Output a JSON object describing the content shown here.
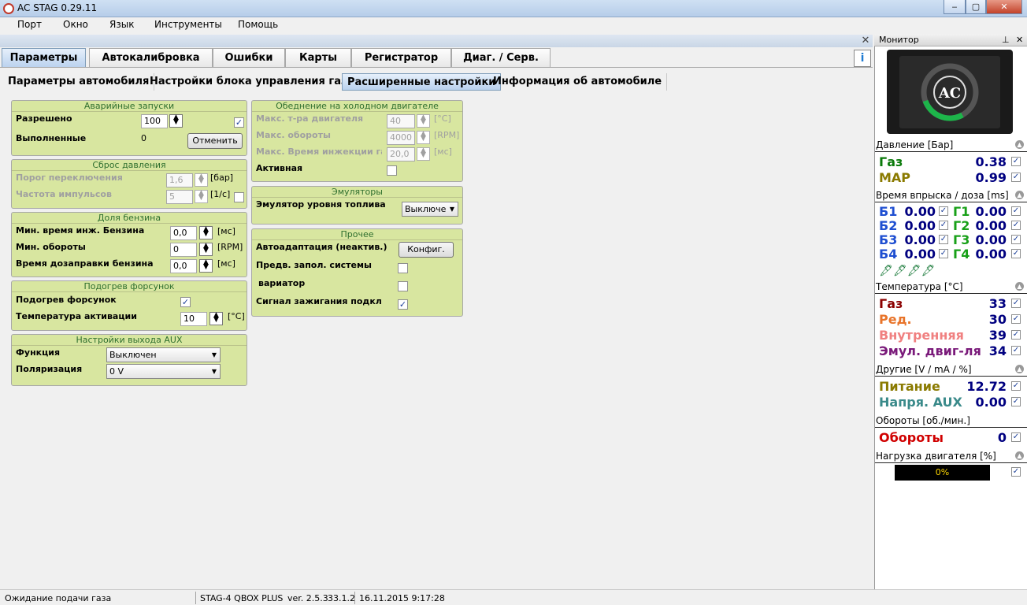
{
  "window": {
    "title": "AC STAG 0.29.11",
    "min": "‒",
    "max": "▢",
    "close": "✕"
  },
  "menu": [
    "Порт",
    "Окно",
    "Язык",
    "Инструменты",
    "Помощь"
  ],
  "tabs": [
    "Параметры",
    "Автокалибровка",
    "Ошибки",
    "Карты",
    "Регистратор",
    "Диаг. / Серв."
  ],
  "active_tab": "Параметры",
  "subtabs": [
    "Параметры автомобиля",
    "Настройки блока управления газа",
    "Расширенные настройки",
    "Информация об автомобиле"
  ],
  "active_subtab": "Расширенные настройки",
  "info_button": "i",
  "emergency": {
    "title": "Аварийные запуски",
    "allowed_label": "Разрешено",
    "allowed_value": "100",
    "allowed_checked": "✓",
    "done_label": "Выполненные",
    "done_value": "0",
    "cancel": "Отменить"
  },
  "pressure_reset": {
    "title": "Сброс давления",
    "threshold_label": "Порог переключения",
    "threshold_value": "1,6",
    "threshold_unit": "[бар]",
    "freq_label": "Частота импульсов",
    "freq_value": "5",
    "freq_unit": "[1/c]"
  },
  "petrol_share": {
    "title": "Доля бензина",
    "rows": [
      {
        "label": "Мин. время инж. Бензина",
        "value": "0,0",
        "unit": "[мс]"
      },
      {
        "label": "Мин. обороты",
        "value": "0",
        "unit": "[RPM]"
      },
      {
        "label": "Время дозаправки бензина",
        "value": "0,0",
        "unit": "[мс]"
      }
    ]
  },
  "injector_heat": {
    "title": "Подогрев форсунок",
    "enable_label": "Подогрев форсунок",
    "enable_checked": "✓",
    "temp_label": "Температура активации",
    "temp_value": "10",
    "temp_unit": "[°C]"
  },
  "aux": {
    "title": "Настройки выхода AUX",
    "function_label": "Функция",
    "function_value": "Выключен",
    "polarity_label": "Поляризация",
    "polarity_value": "0 V"
  },
  "cold_lean": {
    "title": "Обеднение на холодном двигателе",
    "rows": [
      {
        "label": "Макс. т-ра двигателя",
        "value": "40",
        "unit": "[°C]"
      },
      {
        "label": "Макс. обороты",
        "value": "4000",
        "unit": "[RPM]"
      },
      {
        "label": "Макс. Время инжекции газа",
        "value": "20,0",
        "unit": "[мс]"
      }
    ],
    "active_label": "Активная"
  },
  "emulators": {
    "title": "Эмуляторы",
    "fuel_level_label": "Эмулятор уровня топлива",
    "fuel_level_value": "Выключе"
  },
  "other": {
    "title": "Прочее",
    "autoadapt_label": "Автоадаптация (неактив.)",
    "config_button": "Конфиг.",
    "prefill_label": "Предв. запол. системы",
    "variator_label": "вариатор",
    "ignition_label": "Сигнал зажигания подклю",
    "ignition_checked": "✓"
  },
  "monitor": {
    "title": "Монитор",
    "pin": "⊥",
    "close": "✕",
    "logo": "AC",
    "pressure_header": "Давление [Бар]",
    "pressure": [
      {
        "name": "Газ",
        "value": "0.38",
        "color": "#0a7a0a"
      },
      {
        "name": "MAP",
        "value": "0.99",
        "color": "#8a7a00"
      }
    ],
    "injection_header": "Время впрыска / доза [ms]",
    "injection": [
      {
        "b": "Б1",
        "bv": "0.00",
        "g": "Г1",
        "gv": "0.00"
      },
      {
        "b": "Б2",
        "bv": "0.00",
        "g": "Г2",
        "gv": "0.00"
      },
      {
        "b": "Б3",
        "bv": "0.00",
        "g": "Г3",
        "gv": "0.00"
      },
      {
        "b": "Б4",
        "bv": "0.00",
        "g": "Г4",
        "gv": "0.00"
      }
    ],
    "temp_header": "Температура [°C]",
    "temps": [
      {
        "name": "Газ",
        "value": "33",
        "color": "#8b0000"
      },
      {
        "name": "Ред.",
        "value": "30",
        "color": "#e8742a"
      },
      {
        "name": "Внутренняя",
        "value": "39",
        "color": "#f08080"
      },
      {
        "name": "Эмул. двиг-ля",
        "value": "34",
        "color": "#7a1a7a"
      }
    ],
    "other_header": "Другие [V / mA / %]",
    "others": [
      {
        "name": "Питание",
        "value": "12.72",
        "color": "#8a7a00"
      },
      {
        "name": "Напря. AUX",
        "value": "0.00",
        "color": "#3a8a8a"
      }
    ],
    "rpm_header": "Обороты [об./мин.]",
    "rpm": {
      "name": "Обороты",
      "value": "0",
      "color": "#d00000"
    },
    "load_header": "Нагрузка двигателя [%]",
    "load_value": "0%",
    "load_fraction": 0
  },
  "status": {
    "left": "Ожидание подачи газа",
    "device": "STAG-4 QBOX PLUS",
    "version": "ver. 2.5.3",
    "build": "33.1.2",
    "datetime": "16.11.2015 9:17:28"
  },
  "colors": {
    "panel": "#d8e6a0",
    "accent": "#b9d1ee",
    "value_blue": "#000080"
  }
}
